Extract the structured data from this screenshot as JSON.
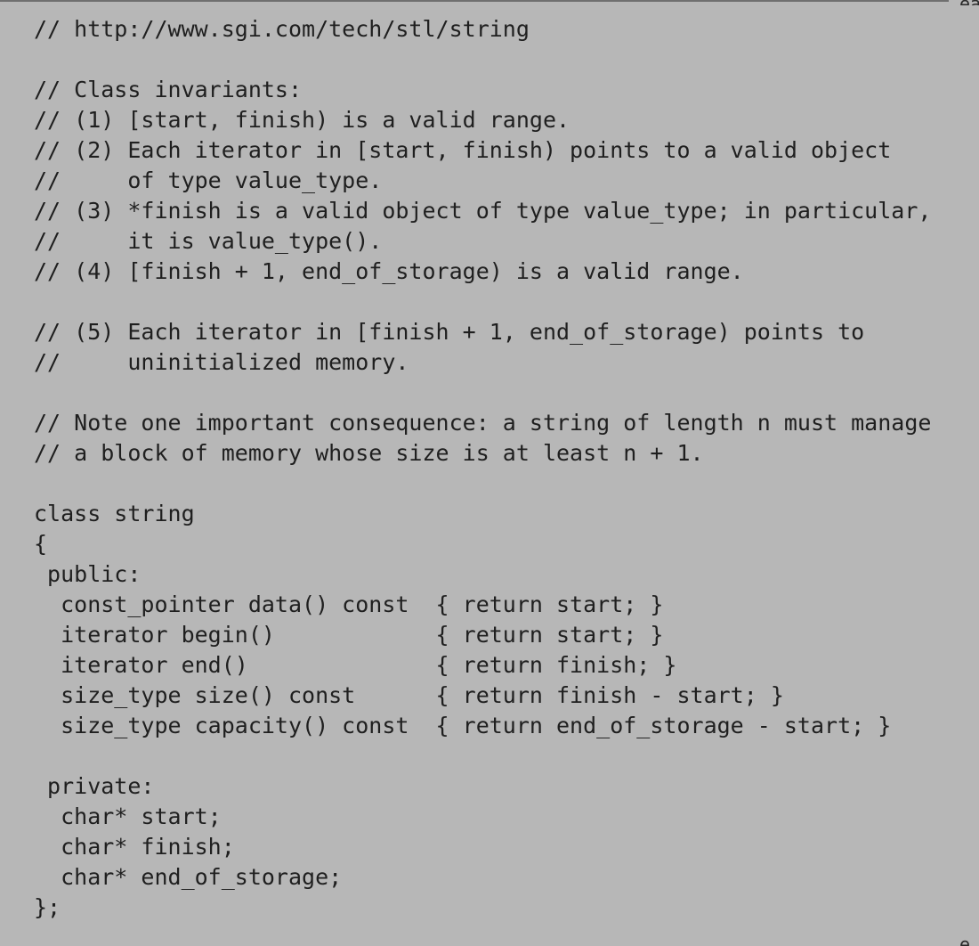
{
  "document": {
    "edge_top": "ea",
    "edge_bottom": "e",
    "lines": [
      "// http://www.sgi.com/tech/stl/string",
      "",
      "// Class invariants:",
      "// (1) [start, finish) is a valid range.",
      "// (2) Each iterator in [start, finish) points to a valid object",
      "//     of type value_type.",
      "// (3) *finish is a valid object of type value_type; in particular,",
      "//     it is value_type().",
      "// (4) [finish + 1, end_of_storage) is a valid range.",
      "",
      "// (5) Each iterator in [finish + 1, end_of_storage) points to",
      "//     uninitialized memory.",
      "",
      "// Note one important consequence: a string of length n must manage",
      "// a block of memory whose size is at least n + 1.",
      "",
      "class string",
      "{",
      " public:",
      "  const_pointer data() const  { return start; }",
      "  iterator begin()            { return start; }",
      "  iterator end()              { return finish; }",
      "  size_type size() const      { return finish - start; }",
      "  size_type capacity() const  { return end_of_storage - start; }",
      "",
      " private:",
      "  char* start;",
      "  char* finish;",
      "  char* end_of_storage;",
      "};"
    ]
  }
}
